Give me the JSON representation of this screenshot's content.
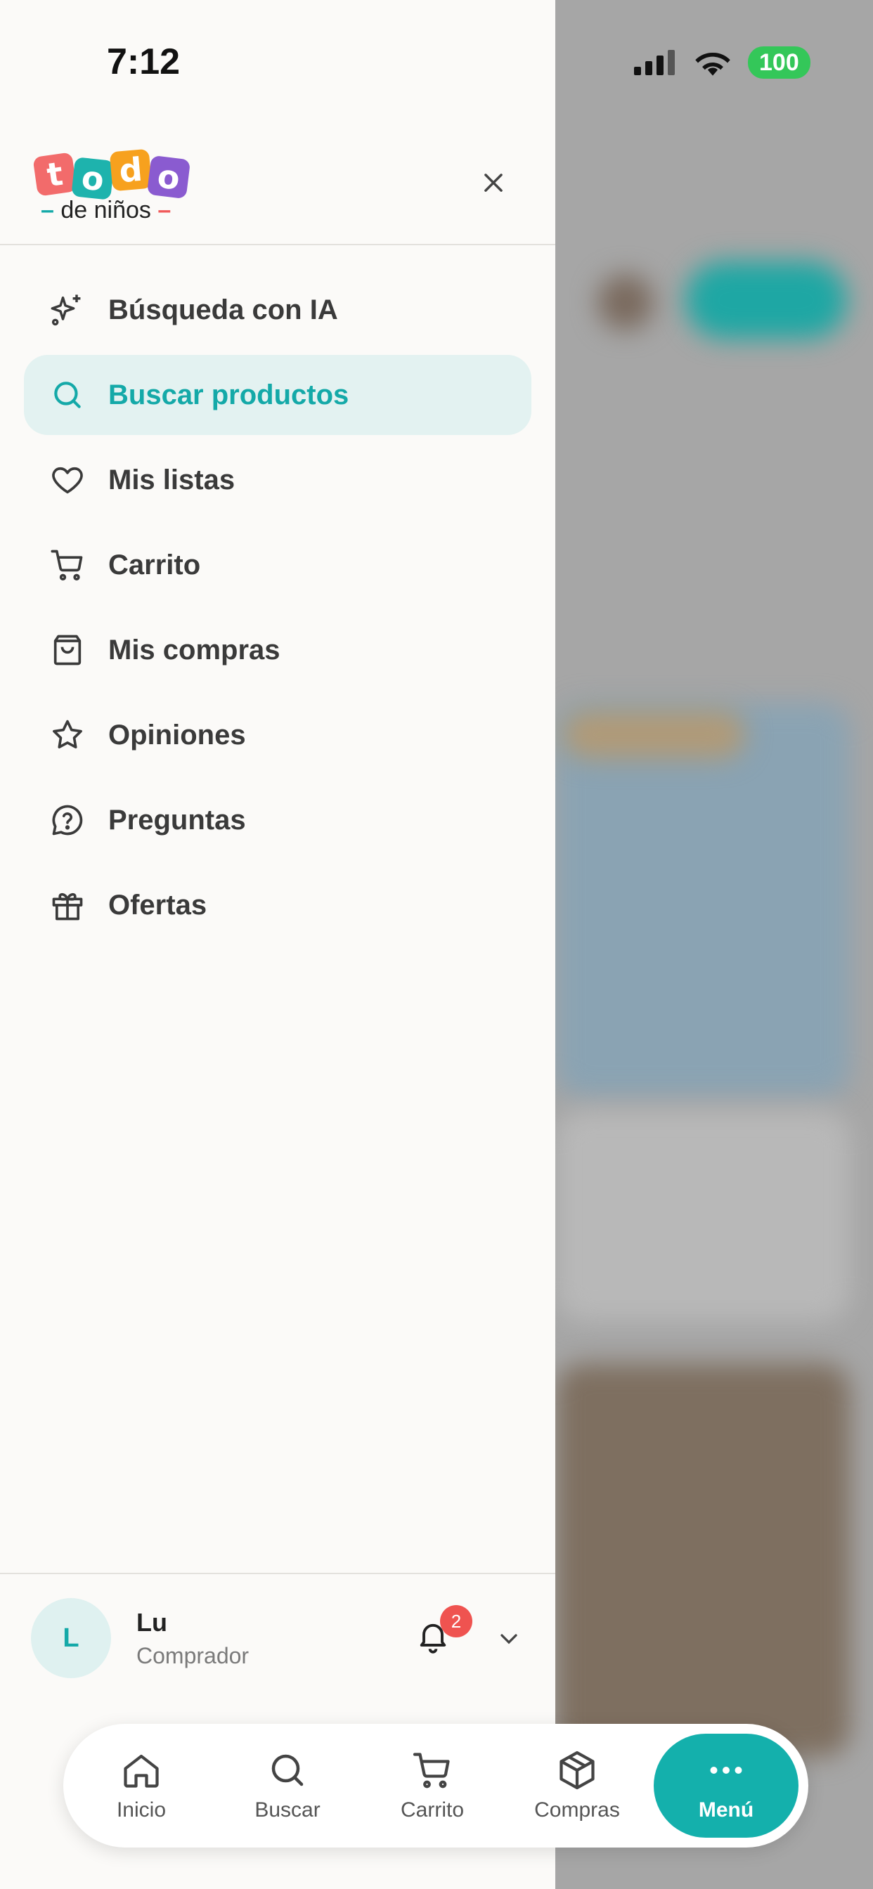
{
  "status": {
    "time": "7:12",
    "battery": "100"
  },
  "logo": {
    "letters": [
      "t",
      "o",
      "d",
      "o"
    ],
    "subtitle": "de niños"
  },
  "menu": {
    "items": [
      {
        "label": "Búsqueda con IA",
        "icon": "sparkles-icon"
      },
      {
        "label": "Buscar productos",
        "icon": "search-icon",
        "active": true
      },
      {
        "label": "Mis listas",
        "icon": "heart-icon"
      },
      {
        "label": "Carrito",
        "icon": "cart-icon"
      },
      {
        "label": "Mis compras",
        "icon": "shopping-bag-icon"
      },
      {
        "label": "Opiniones",
        "icon": "star-icon"
      },
      {
        "label": "Preguntas",
        "icon": "question-bubble-icon"
      },
      {
        "label": "Ofertas",
        "icon": "gift-icon"
      }
    ]
  },
  "user": {
    "initial": "L",
    "name": "Lu",
    "role": "Comprador",
    "notifications": "2"
  },
  "tabbar": {
    "tabs": [
      {
        "label": "Inicio",
        "icon": "home-icon"
      },
      {
        "label": "Buscar",
        "icon": "search-icon"
      },
      {
        "label": "Carrito",
        "icon": "cart-icon"
      },
      {
        "label": "Compras",
        "icon": "package-icon"
      },
      {
        "label": "Menú",
        "icon": "more-dots-icon",
        "active": true
      }
    ]
  },
  "colors": {
    "accent": "#14b0ac",
    "active_bg": "#e3f2f1",
    "badge": "#ef5350",
    "battery": "#34c759"
  }
}
